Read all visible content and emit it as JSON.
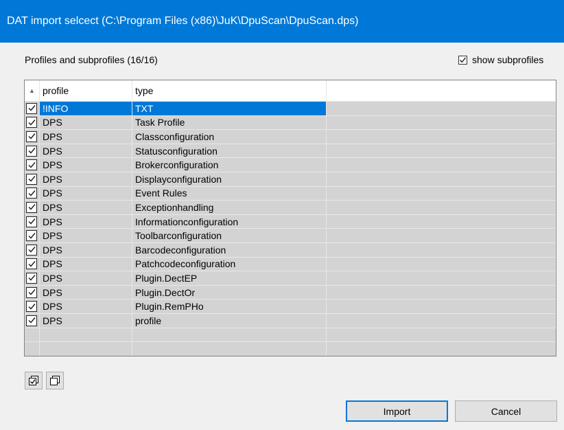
{
  "window": {
    "title": "DAT import selcect (C:\\Program Files (x86)\\JuK\\DpuScan\\DpuScan.dps)"
  },
  "group": {
    "label": "Profiles and subprofiles (16/16)"
  },
  "show_subprofiles": {
    "label": "show subprofiles",
    "checked": true
  },
  "grid": {
    "columns": [
      "profile",
      "type"
    ],
    "sort_indicator": "▲",
    "rows": [
      {
        "profile": "!INFO",
        "type": "TXT",
        "checked": true,
        "selected": true
      },
      {
        "profile": "DPS",
        "type": "Task Profile",
        "checked": true
      },
      {
        "profile": "DPS",
        "type": "Classconfiguration",
        "checked": true
      },
      {
        "profile": "DPS",
        "type": "Statusconfiguration",
        "checked": true
      },
      {
        "profile": "DPS",
        "type": "Brokerconfiguration",
        "checked": true
      },
      {
        "profile": "DPS",
        "type": "Displayconfiguration",
        "checked": true
      },
      {
        "profile": "DPS",
        "type": "Event Rules",
        "checked": true
      },
      {
        "profile": "DPS",
        "type": "Exceptionhandling",
        "checked": true
      },
      {
        "profile": "DPS",
        "type": "Informationconfiguration",
        "checked": true
      },
      {
        "profile": "DPS",
        "type": "Toolbarconfiguration",
        "checked": true
      },
      {
        "profile": "DPS",
        "type": "Barcodeconfiguration",
        "checked": true
      },
      {
        "profile": "DPS",
        "type": "Patchcodeconfiguration",
        "checked": true
      },
      {
        "profile": "DPS",
        "type": "Plugin.DectEP",
        "checked": true
      },
      {
        "profile": "DPS",
        "type": "Plugin.DectOr",
        "checked": true
      },
      {
        "profile": "DPS",
        "type": "Plugin.RemPHo",
        "checked": true
      },
      {
        "profile": "DPS",
        "type": "profile",
        "checked": true
      }
    ]
  },
  "tools": {
    "check_all_icon": "check-all-icon",
    "uncheck_all_icon": "uncheck-all-icon"
  },
  "buttons": {
    "import": "Import",
    "cancel": "Cancel"
  },
  "colors": {
    "title_bar": "#0078d7",
    "selection": "#0078d7",
    "row_background": "#d3d3d3"
  }
}
